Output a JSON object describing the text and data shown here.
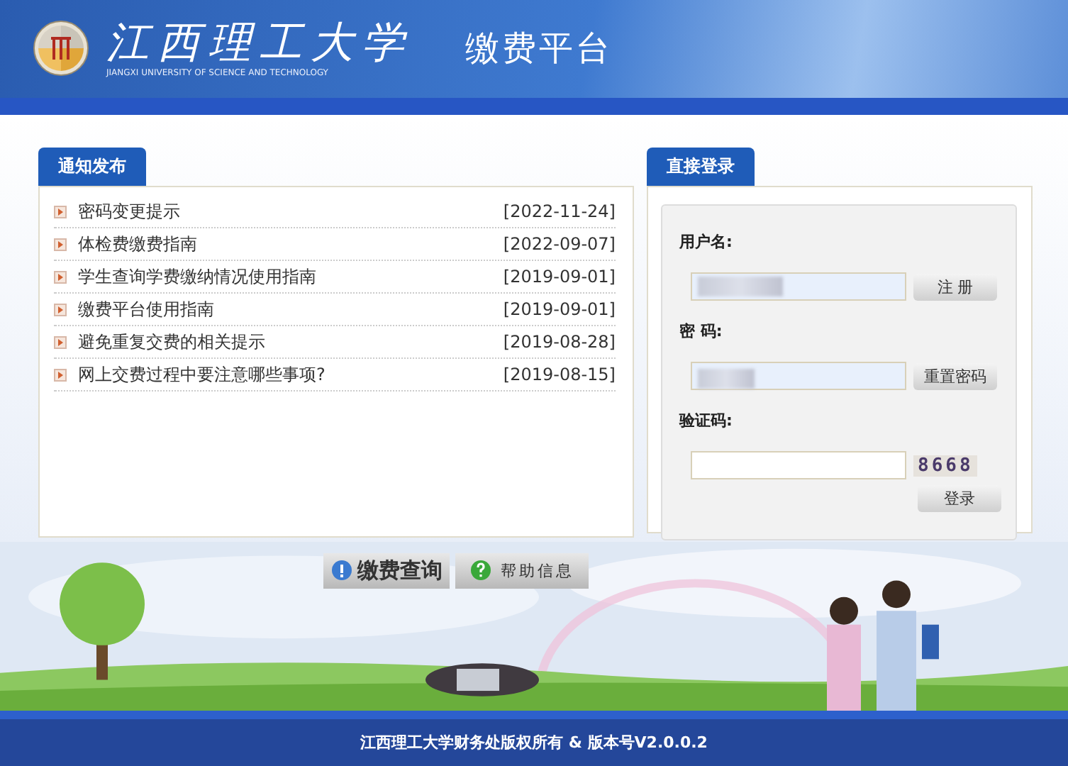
{
  "header": {
    "school_name": "江西理工大学",
    "school_name_en": "JIANGXI UNIVERSITY OF SCIENCE AND TECHNOLOGY",
    "platform": "缴费平台"
  },
  "notices": {
    "tab": "通知发布",
    "items": [
      {
        "title": "密码变更提示",
        "date": "[2022-11-24]"
      },
      {
        "title": "体检费缴费指南",
        "date": "[2022-09-07]"
      },
      {
        "title": "学生查询学费缴纳情况使用指南",
        "date": "[2019-09-01]"
      },
      {
        "title": "缴费平台使用指南",
        "date": "[2019-09-01]"
      },
      {
        "title": "避免重复交费的相关提示",
        "date": "[2019-08-28]"
      },
      {
        "title": "网上交费过程中要注意哪些事项?",
        "date": "[2019-08-15]"
      }
    ]
  },
  "login": {
    "tab": "直接登录",
    "username_label": "用户名:",
    "register": "注 册",
    "password_label": "密 码:",
    "reset": "重置密码",
    "captcha_label": "验证码:",
    "captcha": "8668",
    "submit": "登录"
  },
  "banner": {
    "query": "缴费查询",
    "help": "帮助信息"
  },
  "footer": "江西理工大学财务处版权所有 & 版本号V2.0.0.2"
}
